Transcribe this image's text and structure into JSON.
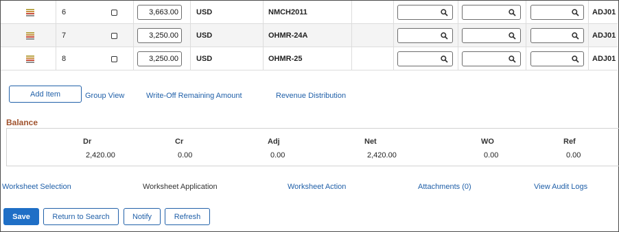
{
  "grid": {
    "rows": [
      {
        "line": "6",
        "amount": "3,663.00",
        "currency": "USD",
        "reference": "NMCH2011",
        "code": "ADJ01"
      },
      {
        "line": "7",
        "amount": "3,250.00",
        "currency": "USD",
        "reference": "OHMR-24A",
        "code": "ADJ01"
      },
      {
        "line": "8",
        "amount": "3,250.00",
        "currency": "USD",
        "reference": "OHMR-25",
        "code": "ADJ01"
      }
    ]
  },
  "actions": {
    "add_item": "Add Item",
    "group_view": "Group View",
    "write_off": "Write-Off Remaining Amount",
    "revenue_distribution": "Revenue Distribution"
  },
  "balance": {
    "title": "Balance",
    "headers": [
      "Dr",
      "Cr",
      "Adj",
      "Net",
      "WO",
      "Ref"
    ],
    "values": [
      "2,420.00",
      "0.00",
      "0.00",
      "2,420.00",
      "0.00",
      "0.00"
    ]
  },
  "nav": {
    "selection": "Worksheet Selection",
    "application": "Worksheet Application",
    "action": "Worksheet Action",
    "attachments": "Attachments (0)",
    "audit": "View Audit Logs"
  },
  "buttons": {
    "save": "Save",
    "return": "Return to Search",
    "notify": "Notify",
    "refresh": "Refresh"
  },
  "colors": {
    "accent": "#1f6fc6",
    "link": "#1f5fa8",
    "section_title": "#a0522d"
  },
  "icons": {
    "row_detail": "notes-icon",
    "prompt": "search-icon"
  }
}
